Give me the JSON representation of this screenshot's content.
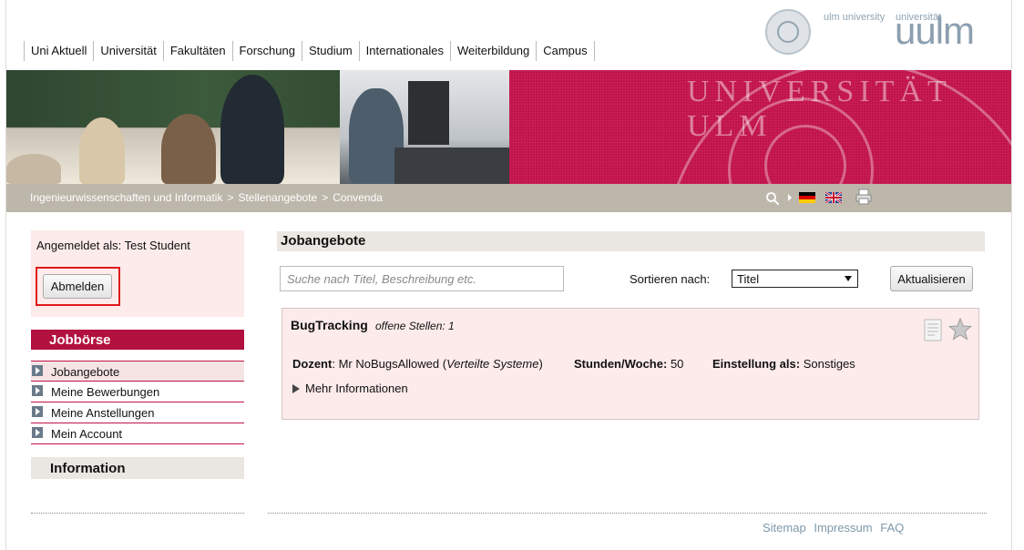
{
  "nav": {
    "items": [
      "Uni Aktuell",
      "Universität",
      "Fakultäten",
      "Forschung",
      "Studium",
      "Internationales",
      "Weiterbildung",
      "Campus"
    ]
  },
  "logo": {
    "ulm_university": "ulm university",
    "universitaet": "universität",
    "wordmark": "uulm"
  },
  "banner": {
    "seal_text": "UNIVERSITÄT ULM"
  },
  "breadcrumb": {
    "items": [
      "Ingenieurwissenschaften und Informatik",
      "Stellenangebote",
      "Convenda"
    ],
    "separator": ">"
  },
  "sidebar": {
    "logged_in_text": "Angemeldet als: Test Student",
    "logout_label": "Abmelden",
    "jobboerse_title": "Jobbörse",
    "menu": [
      "Jobangebote",
      "Meine Bewerbungen",
      "Meine Anstellungen",
      "Mein Account"
    ],
    "information_title": "Information"
  },
  "main": {
    "title": "Jobangebote",
    "search_placeholder": "Suche nach Titel, Beschreibung etc.",
    "sort_label": "Sortieren nach:",
    "sort_value": "Titel",
    "refresh_label": "Aktualisieren"
  },
  "job": {
    "title": "BugTracking",
    "open_positions_label": "offene Stellen: 1",
    "dozent_label": "Dozent",
    "dozent_value": "Mr NoBugsAllowed",
    "dozent_group": "Verteilte Systeme",
    "hours_label": "Stunden/Woche:",
    "hours_value": "50",
    "employment_label": "Einstellung als:",
    "employment_value": "Sonstiges",
    "more_label": "Mehr Informationen"
  },
  "footer": {
    "links": [
      "Sitemap",
      "Impressum",
      "FAQ"
    ]
  },
  "colors": {
    "crimson": "#c1124a",
    "sidebar_head": "#b2103e",
    "breadcrumb_bar": "#bdb7ab",
    "pink_panel": "#fcebea",
    "footer_link": "#7d98aa",
    "highlight_red": "#e0181b"
  }
}
